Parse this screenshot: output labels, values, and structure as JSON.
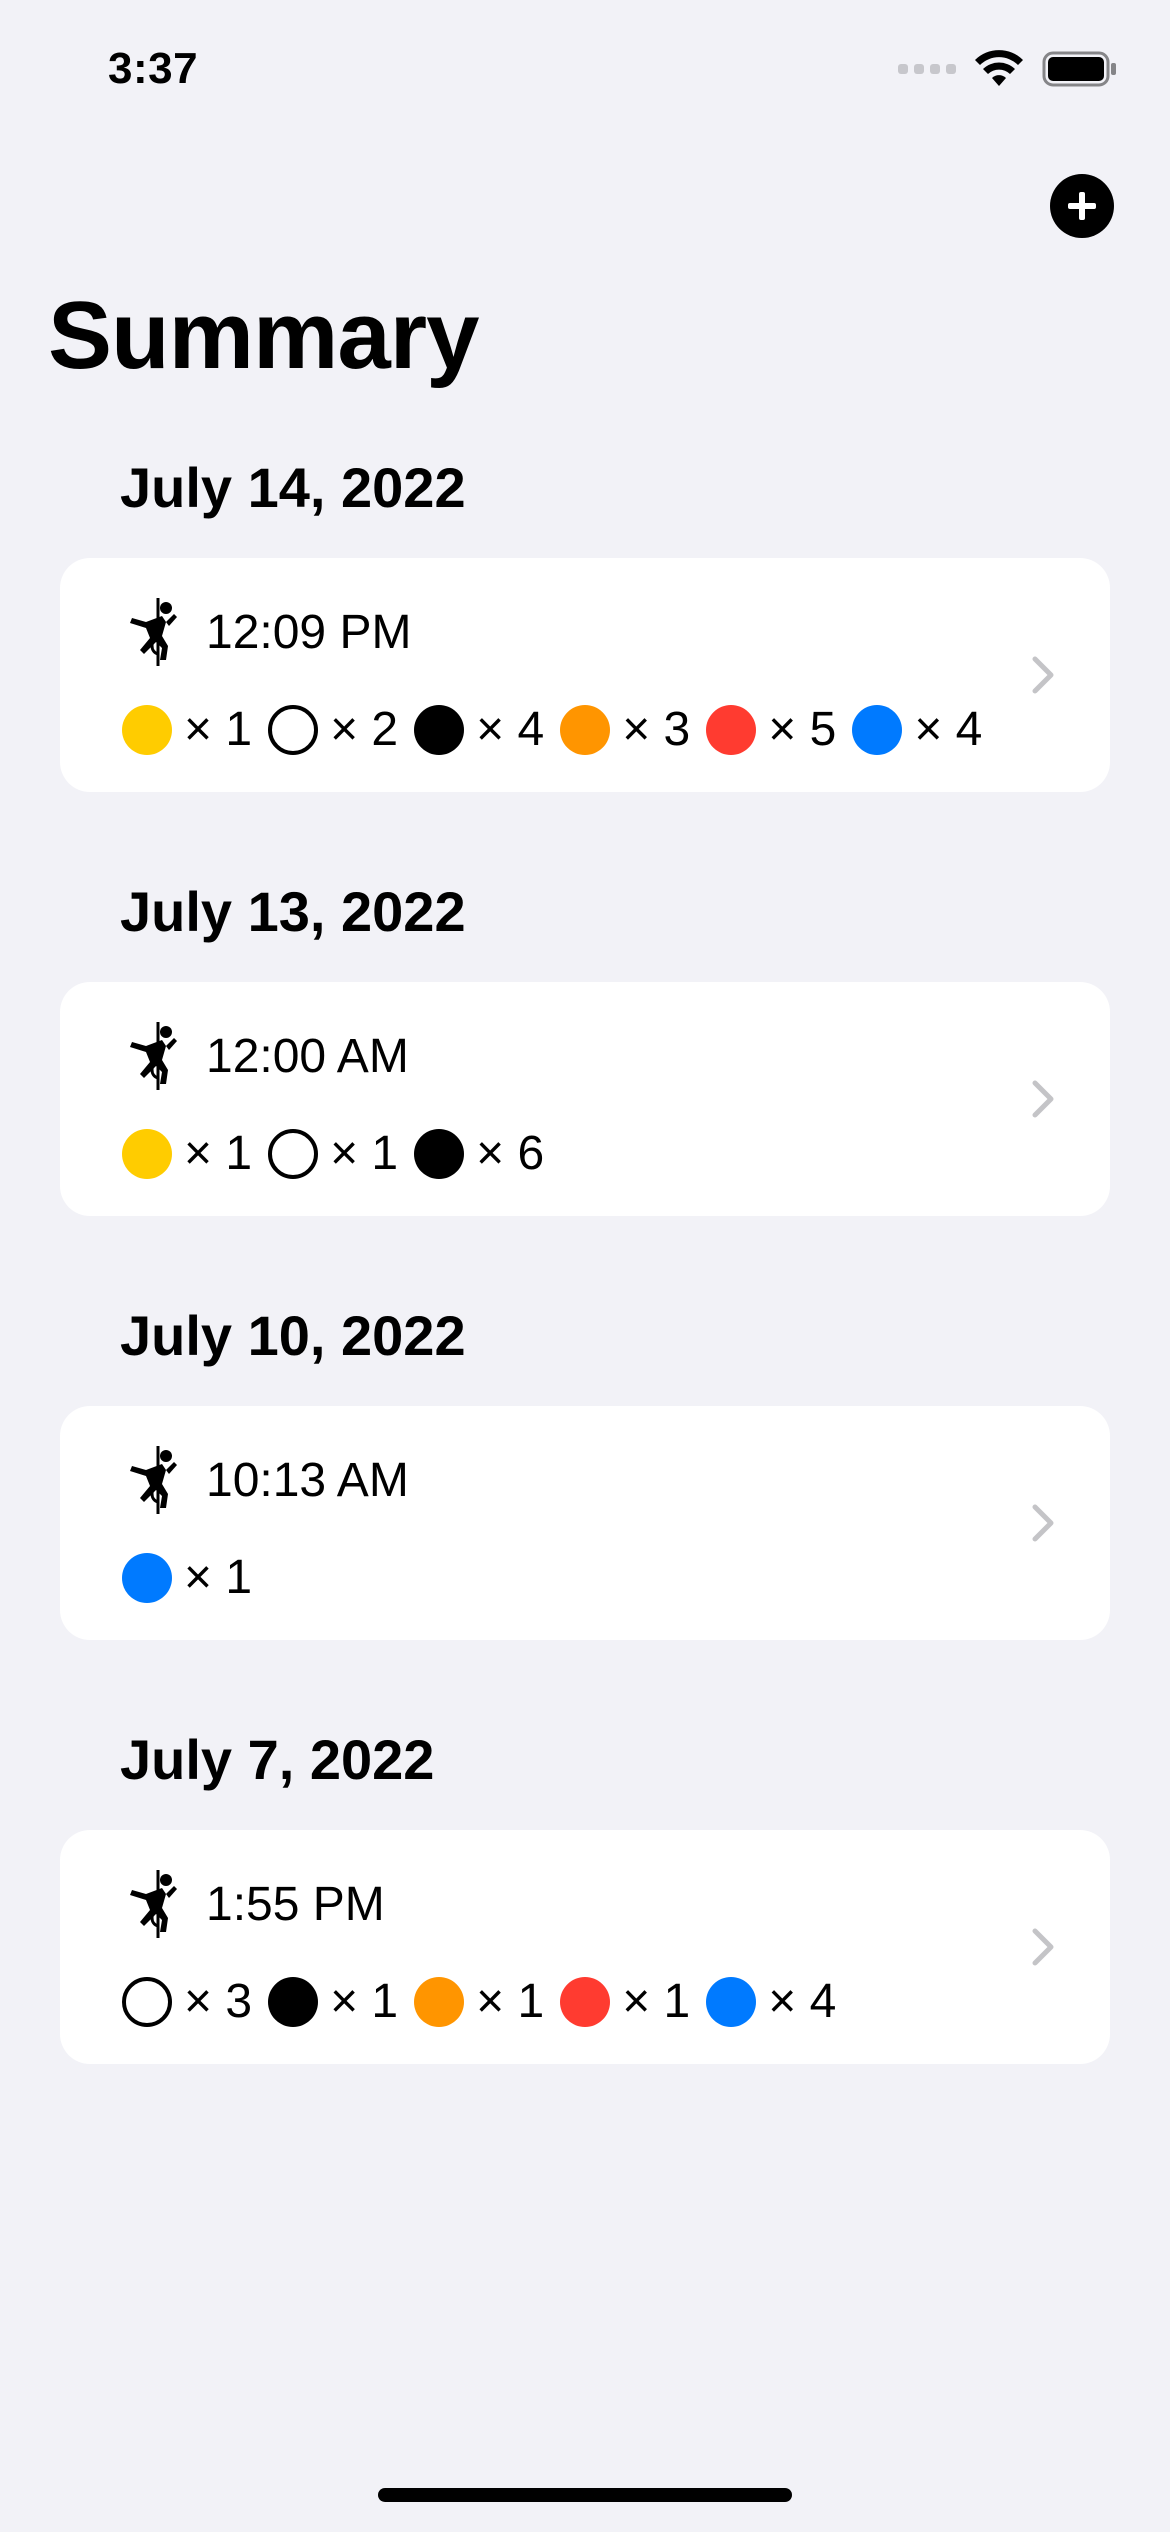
{
  "status_bar": {
    "time": "3:37"
  },
  "nav": {
    "title": "Summary",
    "add_icon": "plus-circle-icon"
  },
  "colors": {
    "yellow": "#ffcc00",
    "white": "#ffffff",
    "black": "#000000",
    "orange": "#ff9500",
    "red": "#ff3b30",
    "blue": "#007aff",
    "background": "#f2f2f7",
    "card": "#ffffff",
    "chevron": "#c4c4c7"
  },
  "sessions": [
    {
      "date": "July 14, 2022",
      "time": "12:09 PM",
      "icon": "climbing-icon",
      "holds": [
        {
          "color": "yellow",
          "count": "× 1"
        },
        {
          "color": "white",
          "count": "× 2"
        },
        {
          "color": "black",
          "count": "× 4"
        },
        {
          "color": "orange",
          "count": "× 3"
        },
        {
          "color": "red",
          "count": "× 5"
        },
        {
          "color": "blue",
          "count": "× 4"
        }
      ]
    },
    {
      "date": "July 13, 2022",
      "time": "12:00 AM",
      "icon": "climbing-icon",
      "holds": [
        {
          "color": "yellow",
          "count": "× 1"
        },
        {
          "color": "white",
          "count": "× 1"
        },
        {
          "color": "black",
          "count": "× 6"
        }
      ]
    },
    {
      "date": "July 10, 2022",
      "time": "10:13 AM",
      "icon": "climbing-icon",
      "holds": [
        {
          "color": "blue",
          "count": "× 1"
        }
      ]
    },
    {
      "date": "July 7, 2022",
      "time": "1:55 PM",
      "icon": "climbing-icon",
      "holds": [
        {
          "color": "white",
          "count": "× 3"
        },
        {
          "color": "black",
          "count": "× 1"
        },
        {
          "color": "orange",
          "count": "× 1"
        },
        {
          "color": "red",
          "count": "× 1"
        },
        {
          "color": "blue",
          "count": "× 4"
        }
      ]
    }
  ]
}
